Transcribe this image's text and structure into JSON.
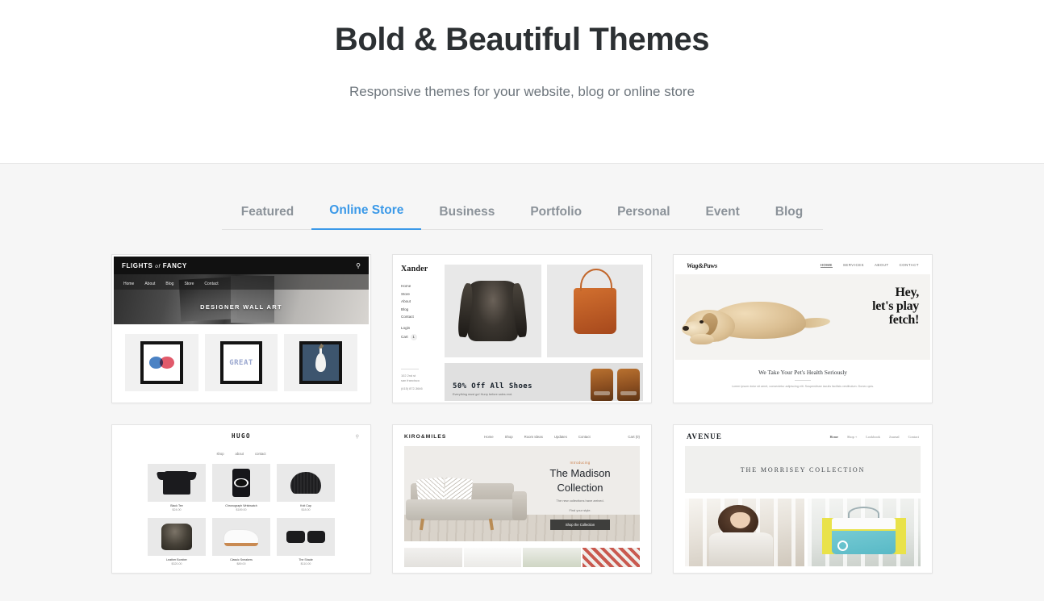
{
  "header": {
    "title": "Bold & Beautiful Themes",
    "subtitle": "Responsive themes for your website, blog or online store"
  },
  "tabs": [
    {
      "label": "Featured",
      "active": false
    },
    {
      "label": "Online Store",
      "active": true
    },
    {
      "label": "Business",
      "active": false
    },
    {
      "label": "Portfolio",
      "active": false
    },
    {
      "label": "Personal",
      "active": false
    },
    {
      "label": "Event",
      "active": false
    },
    {
      "label": "Blog",
      "active": false
    }
  ],
  "colors": {
    "accent": "#3b99e8",
    "tab_inactive": "#8b9299",
    "title": "#2c3033",
    "subtitle": "#6d757c",
    "section_bg": "#f6f6f6",
    "card_border": "#e4e4e4"
  },
  "themes": [
    {
      "name": "flights-of-fancy",
      "logo": "FLIGHTS",
      "logo_italic": "of",
      "logo_tail": "FANCY",
      "nav": [
        "Home",
        "About",
        "Blog",
        "Store",
        "Contact"
      ],
      "hero_text": "DESIGNER WALL ART",
      "art": [
        "venn",
        "GREAT",
        "vase"
      ],
      "search_icon": "search-icon"
    },
    {
      "name": "xander",
      "logo": "Xander",
      "nav": [
        "Home",
        "Store",
        "About",
        "Blog",
        "Contact"
      ],
      "account": [
        "Login"
      ],
      "cart_label": "Cart",
      "cart_count": "1",
      "address_line1": "102 2nd st",
      "address_line2": "san francisco",
      "phone": "(415) 872-3646",
      "banner_title": "50% Off All Shoes",
      "banner_sub": "Everything must go! Hurry before sales end."
    },
    {
      "name": "wag-and-paws",
      "logo": "Wag&Paws",
      "nav": [
        "HOME",
        "SERVICES",
        "ABOUT",
        "CONTACT"
      ],
      "headline_line1": "Hey,",
      "headline_line2": "let's play",
      "headline_line3": "fetch!",
      "sub_heading": "We Take Your Pet's Health Seriously",
      "sub_paragraph": "Lorem ipsum dolor sit amet, consectetur adipiscing elit. Suspendisse iaculis facilisis vestibulum. Donec quis."
    },
    {
      "name": "hugo",
      "logo": "HUGO",
      "nav": [
        "shop",
        "about",
        "contact"
      ],
      "search_icon": "search-icon",
      "products": [
        {
          "name": "Black Tee",
          "price": "$24.00",
          "art": "tee"
        },
        {
          "name": "Chronograph Wristwatch",
          "price": "$189.00",
          "art": "watch"
        },
        {
          "name": "Knit Cap",
          "price": "$18.00",
          "art": "beanie"
        },
        {
          "name": "Leather Bomber",
          "price": "$320.00",
          "art": "jacket"
        },
        {
          "name": "Classic Sneakers",
          "price": "$89.00",
          "art": "sneaker"
        },
        {
          "name": "The Shade",
          "price": "$110.00",
          "art": "sunglasses"
        }
      ]
    },
    {
      "name": "kiro-and-miles",
      "logo": "KIRO&MILES",
      "nav": [
        "Home",
        "Shop",
        "Room Ideas",
        "Updates",
        "Contact"
      ],
      "cart_label": "Cart (0)",
      "intro": "Introducing",
      "headline_line1": "The Madison",
      "headline_line2": "Collection",
      "paragraph_line1": "The new collections have arrived.",
      "paragraph_line2": "Find your style.",
      "button_label": "Shop the Collection"
    },
    {
      "name": "avenue",
      "logo": "AVENUE",
      "nav": [
        "Home",
        "Shop +",
        "Lookbook",
        "Journal",
        "Contact"
      ],
      "band_title": "THE MORRISEY COLLECTION"
    }
  ]
}
